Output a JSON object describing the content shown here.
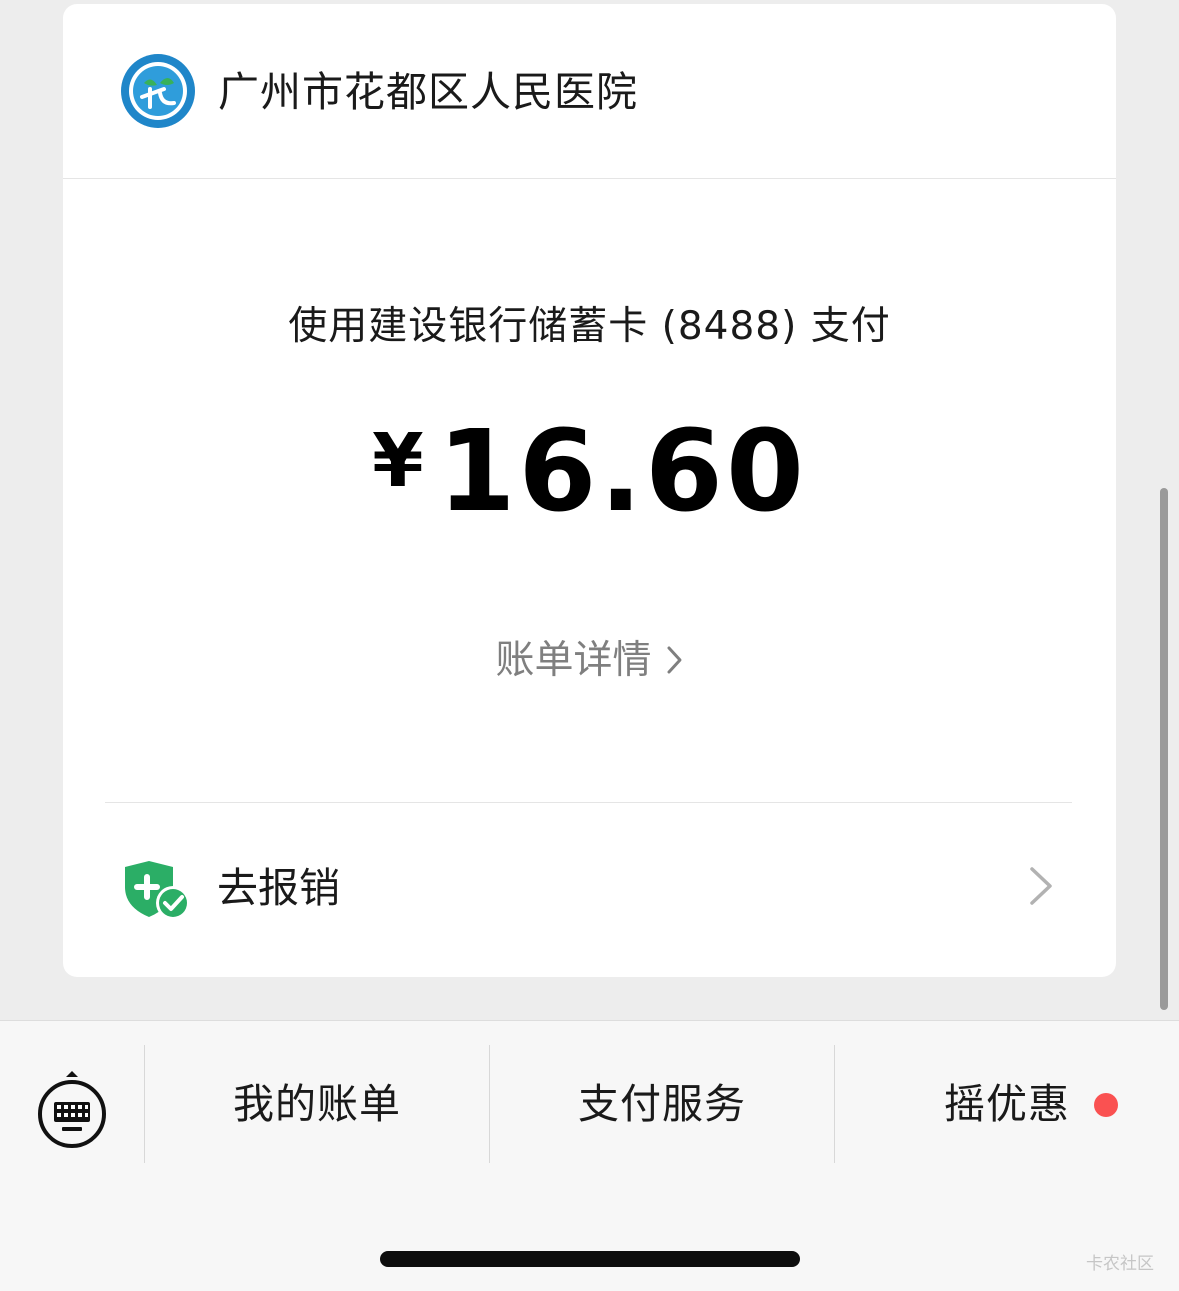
{
  "merchant": {
    "name": "广州市花都区人民医院",
    "logo_icon": "hospital-logo-icon"
  },
  "payment": {
    "method_text": "使用建设银行储蓄卡 (8488) 支付",
    "currency_symbol": "¥",
    "amount": "16.60",
    "bill_detail_label": "账单详情",
    "bill_detail_icon": "chevron-right-icon"
  },
  "reimburse": {
    "label": "去报销",
    "icon": "shield-plus-check-icon",
    "chevron_icon": "chevron-right-icon"
  },
  "bottom_menu": {
    "keyboard_icon": "keyboard-icon",
    "items": [
      {
        "label": "我的账单"
      },
      {
        "label": "支付服务"
      },
      {
        "label": "摇优惠"
      }
    ],
    "badge_color": "#FA5151"
  },
  "watermark": "卡农社区",
  "colors": {
    "background": "#EDEDED",
    "card": "#FFFFFF",
    "accent_green": "#2BAE66",
    "secondary_text": "#7F7F7F"
  }
}
